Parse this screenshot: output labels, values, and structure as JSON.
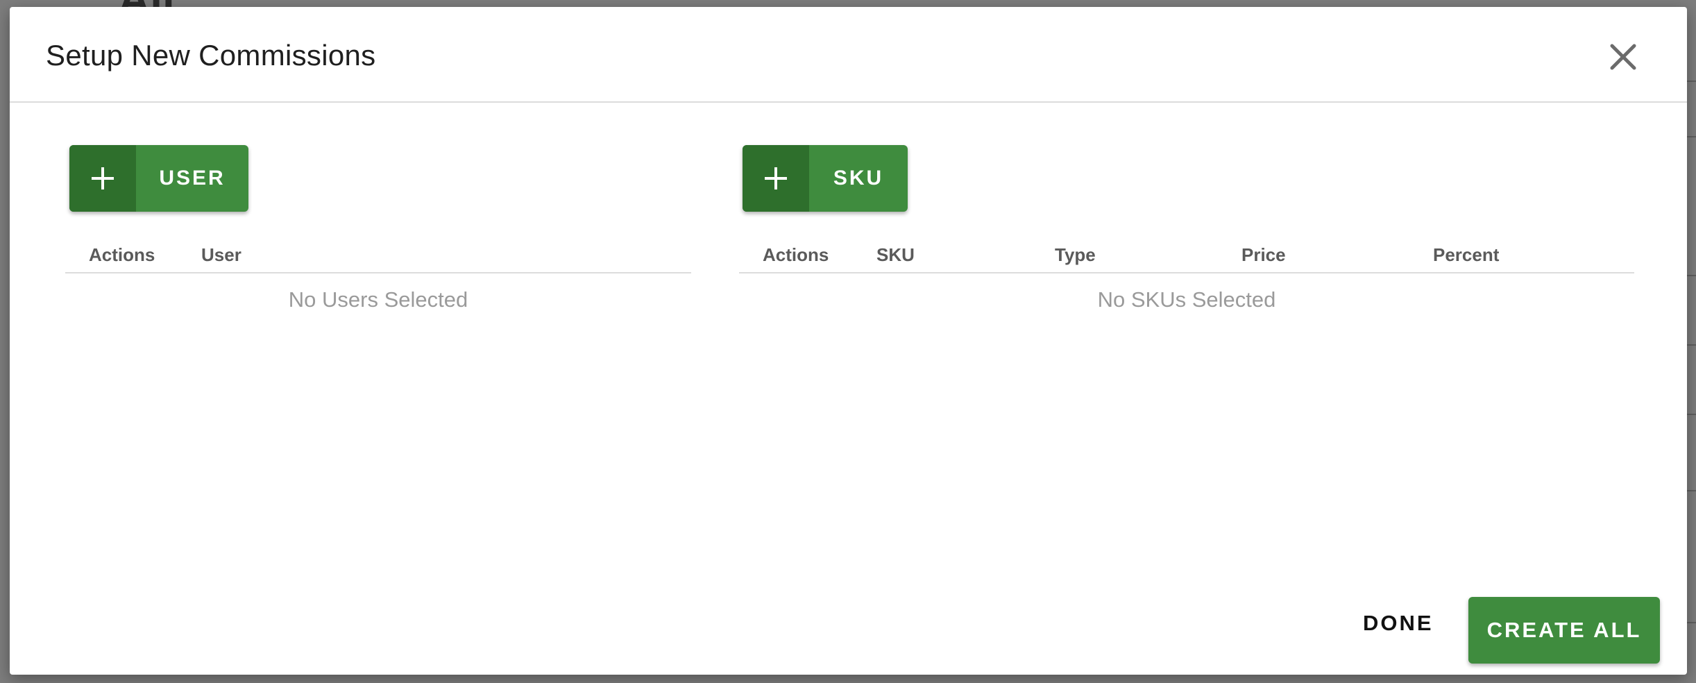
{
  "background": {
    "heading_fragment": "All"
  },
  "modal": {
    "title": "Setup New Commissions",
    "close_icon": "close-icon"
  },
  "users": {
    "add_button_label": "USER",
    "add_icon": "plus-icon",
    "columns": [
      "Actions",
      "User"
    ],
    "empty_message": "No Users Selected"
  },
  "skus": {
    "add_button_label": "SKU",
    "add_icon": "plus-icon",
    "columns": [
      "Actions",
      "SKU",
      "Type",
      "Price",
      "Percent"
    ],
    "empty_message": "No SKUs Selected"
  },
  "footer": {
    "done_label": "DONE",
    "create_all_label": "CREATE ALL"
  },
  "colors": {
    "primary_green": "#3f8c3e",
    "dark_green": "#2e6f2c"
  }
}
